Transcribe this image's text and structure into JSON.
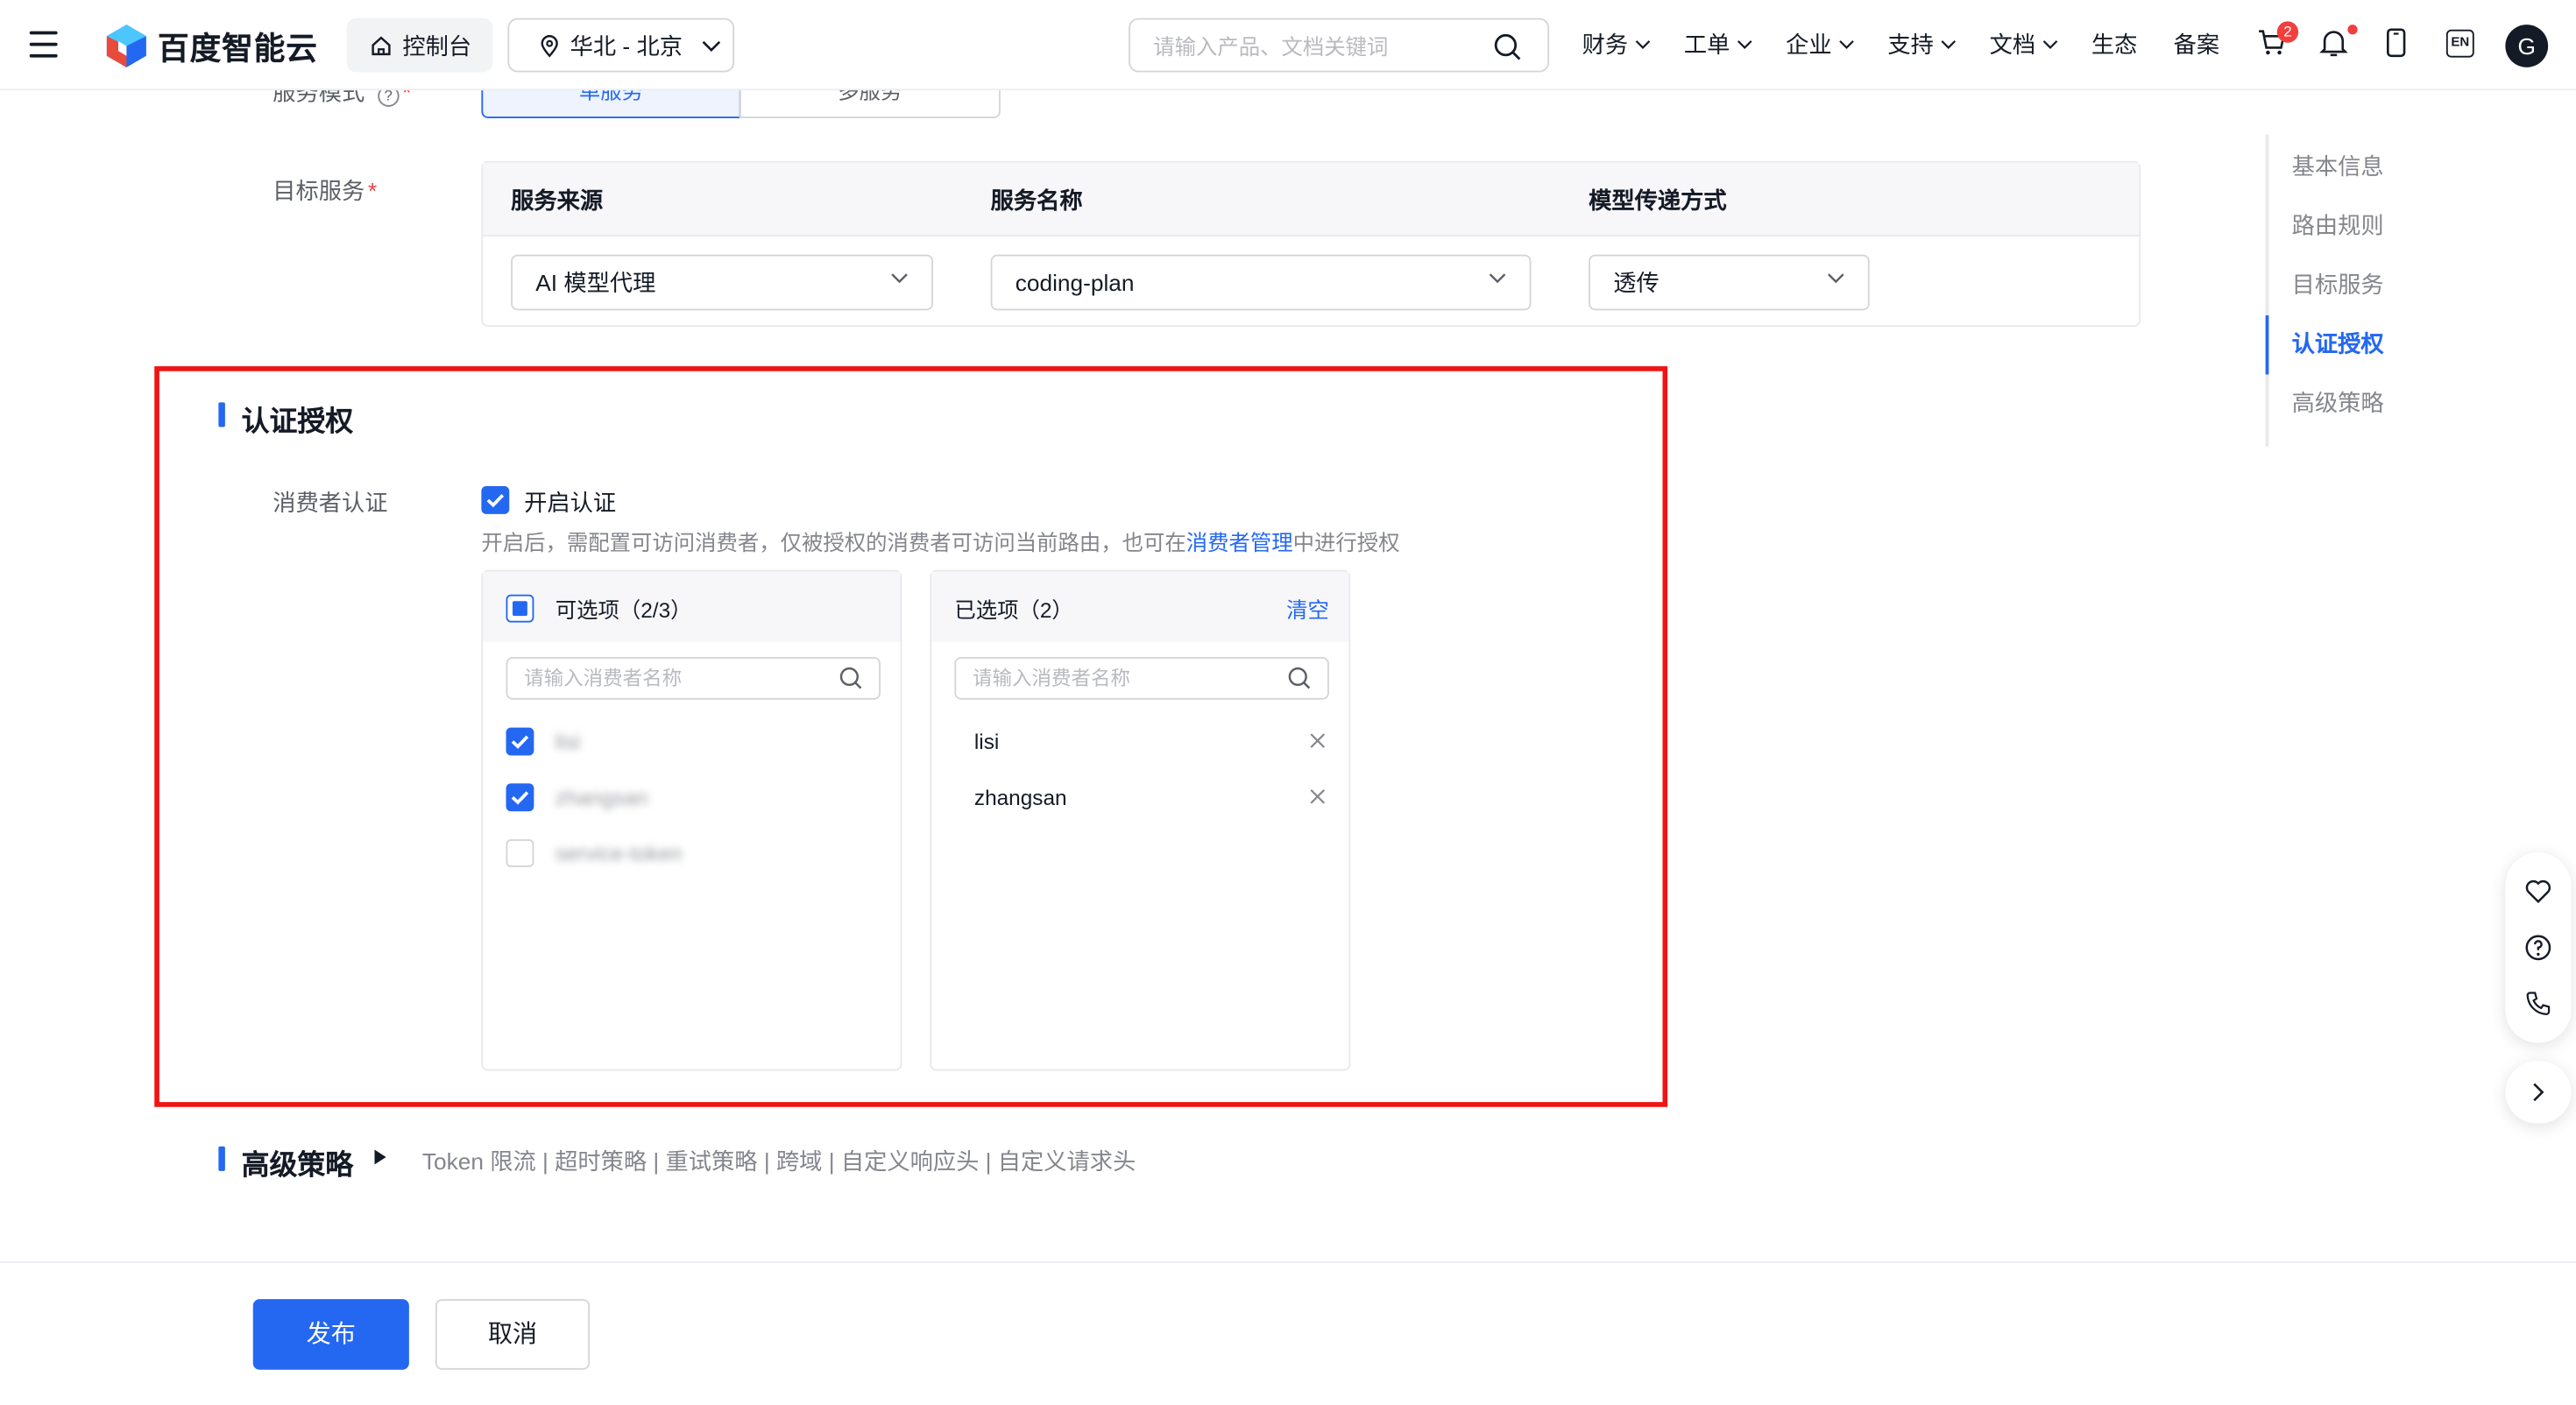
{
  "header": {
    "brand": "百度智能云",
    "console_label": "控制台",
    "region_label": "华北 - 北京",
    "search_placeholder": "请输入产品、文档关键词",
    "menu": [
      {
        "label": "财务",
        "dropdown": true
      },
      {
        "label": "工单",
        "dropdown": true
      },
      {
        "label": "企业",
        "dropdown": true
      },
      {
        "label": "支持",
        "dropdown": true
      },
      {
        "label": "文档",
        "dropdown": true
      },
      {
        "label": "生态",
        "dropdown": false
      },
      {
        "label": "备案",
        "dropdown": false
      }
    ],
    "cart_badge": "2",
    "lang_label": "EN",
    "avatar_letter": "G"
  },
  "form": {
    "service_mode_label": "服务模式",
    "service_mode_options": [
      "单服务",
      "多服务"
    ],
    "target_service_label": "目标服务",
    "target_columns": [
      "服务来源",
      "服务名称",
      "模型传递方式"
    ],
    "target_values": {
      "source": "AI 模型代理",
      "name": "coding-plan",
      "transfer": "透传"
    }
  },
  "auth": {
    "section_title": "认证授权",
    "consumer_auth_label": "消费者认证",
    "enable_label": "开启认证",
    "hint_prefix": "开启后，需配置可访问消费者，仅被授权的消费者可访问当前路由，也可在",
    "hint_link": "消费者管理",
    "hint_suffix": "中进行授权",
    "available": {
      "title": "可选项（2/3）",
      "search_placeholder": "请输入消费者名称",
      "items": [
        {
          "name": "lisi",
          "checked": true
        },
        {
          "name": "zhangsan",
          "checked": true
        },
        {
          "name": "service-token",
          "checked": false
        }
      ]
    },
    "selected": {
      "title": "已选项（2）",
      "clear_label": "清空",
      "search_placeholder": "请输入消费者名称",
      "items": [
        "lisi",
        "zhangsan"
      ]
    }
  },
  "advanced": {
    "section_title": "高级策略",
    "links": "Token 限流 | 超时策略 | 重试策略 | 跨域 | 自定义响应头 | 自定义请求头"
  },
  "toc": {
    "items": [
      "基本信息",
      "路由规则",
      "目标服务",
      "认证授权",
      "高级策略"
    ],
    "active": "认证授权"
  },
  "footer": {
    "publish_label": "发布",
    "cancel_label": "取消"
  },
  "colors": {
    "primary": "#2468f2",
    "highlight_border": "#f01414",
    "danger": "#f33e3e"
  }
}
